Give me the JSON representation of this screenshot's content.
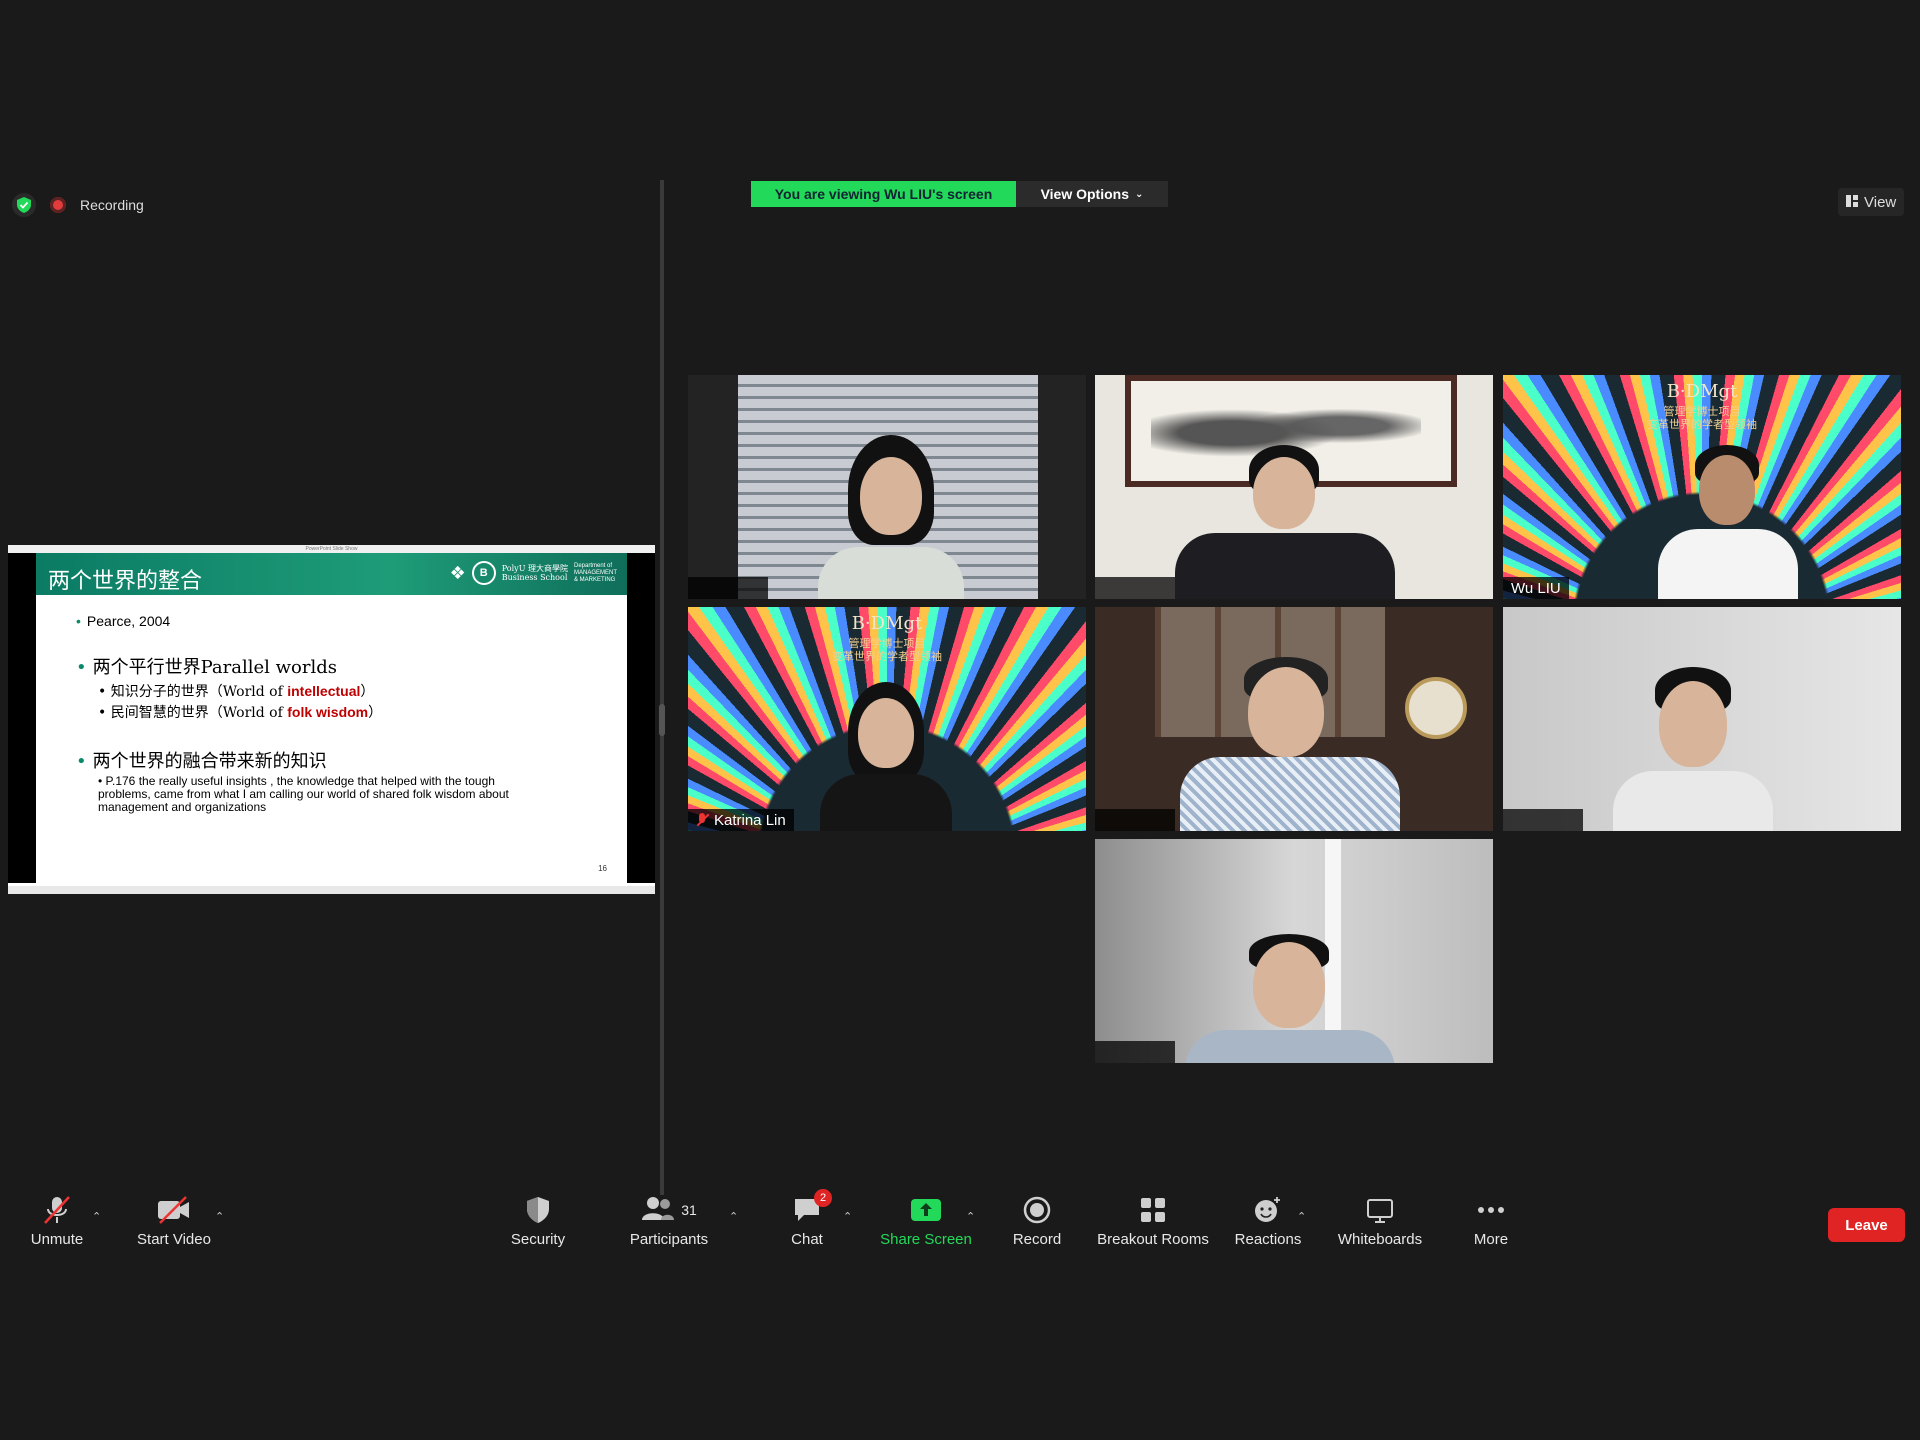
{
  "status": {
    "recording_label": "Recording"
  },
  "screen_share": {
    "banner": "You are viewing Wu LIU's screen",
    "view_options_label": "View Options"
  },
  "view_button_label": "View",
  "slide": {
    "title": "两个世界的整合",
    "school": "PolyU 理大商學院\nBusiness School",
    "department": "Department of\nMANAGEMENT\n& MARKETING",
    "bullet_1": "Pearce, 2004",
    "bullet_2": "两个平行世界Parallel worlds",
    "sub_2a_prefix": "知识分子的世界（World of ",
    "sub_2a_highlight": "intellectual",
    "sub_2a_suffix": "）",
    "sub_2b_prefix": "民间智慧的世界（World of ",
    "sub_2b_highlight": "folk wisdom",
    "sub_2b_suffix": "）",
    "bullet_3": "两个世界的融合带来新的知识",
    "sub_3a": "P.176 the really useful insights , the knowledge that helped with the tough problems, came from what I am calling our world of shared folk wisdom about management and organizations",
    "page_number": "16"
  },
  "participants_tiles": [
    {
      "name": ""
    },
    {
      "name": ""
    },
    {
      "name": "Wu LIU"
    },
    {
      "name": "Katrina Lin",
      "muted": true
    },
    {
      "name": ""
    },
    {
      "name": ""
    },
    {
      "name": ""
    }
  ],
  "dmgt_background": {
    "logo": "B·DMgt",
    "line1": "管理学博士项目",
    "line2": "变革世界的学者型领袖"
  },
  "toolbar": {
    "unmute": "Unmute",
    "start_video": "Start Video",
    "security": "Security",
    "participants": "Participants",
    "participants_count": "31",
    "chat": "Chat",
    "chat_badge": "2",
    "share_screen": "Share Screen",
    "record": "Record",
    "breakout_rooms": "Breakout Rooms",
    "reactions": "Reactions",
    "whiteboards": "Whiteboards",
    "more": "More",
    "leave": "Leave"
  },
  "colors": {
    "accent_green": "#23d959",
    "leave_red": "#e02424",
    "background": "#1a1a1a"
  }
}
